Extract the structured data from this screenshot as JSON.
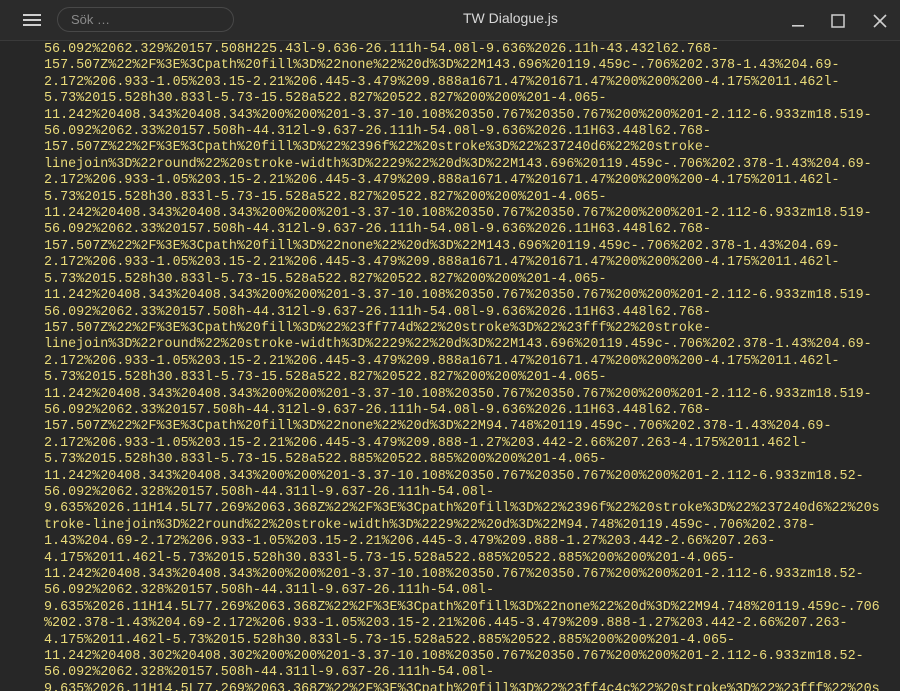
{
  "window": {
    "title": "TW Dialogue.js"
  },
  "search": {
    "placeholder": "Sök …"
  },
  "icons": {
    "menu": "hamburger-icon",
    "minimize": "minimize-icon",
    "maximize": "maximize-icon",
    "close": "close-icon"
  },
  "colors": {
    "text": "#eadb7a",
    "background": "#272727",
    "titlebar": "#2b2b2b"
  },
  "content": {
    "lines": [
      "56.092%2062.329%20157.508H225.43l-9.636-26.111h-54.08l-9.636%2026.11h-43.432l62.768-",
      "157.507Z%22%2F%3E%3Cpath%20fill%3D%22none%22%20d%3D%22M143.696%20119.459c-.706%202.378-1.43%204.69-",
      "2.172%206.933-1.05%203.15-2.21%206.445-3.479%209.888a1671.47%201671.47%200%200%200-4.175%2011.462l-",
      "5.73%2015.528h30.833l-5.73-15.528a522.827%20522.827%200%200%201-4.065-",
      "11.242%20408.343%20408.343%200%200%201-3.37-10.108%20350.767%20350.767%200%200%201-2.112-6.933zm18.519-",
      "56.092%2062.33%20157.508h-44.312l-9.637-26.111h-54.08l-9.636%2026.11H63.448l62.768-",
      "157.507Z%22%2F%3E%3Cpath%20fill%3D%22%2396f%22%20stroke%3D%22%237240d6%22%20stroke-",
      "linejoin%3D%22round%22%20stroke-width%3D%2229%22%20d%3D%22M143.696%20119.459c-.706%202.378-1.43%204.69-",
      "2.172%206.933-1.05%203.15-2.21%206.445-3.479%209.888a1671.47%201671.47%200%200%200-4.175%2011.462l-",
      "5.73%2015.528h30.833l-5.73-15.528a522.827%20522.827%200%200%201-4.065-",
      "11.242%20408.343%20408.343%200%200%201-3.37-10.108%20350.767%20350.767%200%200%201-2.112-6.933zm18.519-",
      "56.092%2062.33%20157.508h-44.312l-9.637-26.111h-54.08l-9.636%2026.11H63.448l62.768-",
      "157.507Z%22%2F%3E%3Cpath%20fill%3D%22none%22%20d%3D%22M143.696%20119.459c-.706%202.378-1.43%204.69-",
      "2.172%206.933-1.05%203.15-2.21%206.445-3.479%209.888a1671.47%201671.47%200%200%200-4.175%2011.462l-",
      "5.73%2015.528h30.833l-5.73-15.528a522.827%20522.827%200%200%201-4.065-",
      "11.242%20408.343%20408.343%200%200%201-3.37-10.108%20350.767%20350.767%200%200%201-2.112-6.933zm18.519-",
      "56.092%2062.33%20157.508h-44.312l-9.637-26.111h-54.08l-9.636%2026.11H63.448l62.768-",
      "157.507Z%22%2F%3E%3Cpath%20fill%3D%22%23ff774d%22%20stroke%3D%22%23fff%22%20stroke-",
      "linejoin%3D%22round%22%20stroke-width%3D%2229%22%20d%3D%22M143.696%20119.459c-.706%202.378-1.43%204.69-",
      "2.172%206.933-1.05%203.15-2.21%206.445-3.479%209.888a1671.47%201671.47%200%200%200-4.175%2011.462l-",
      "5.73%2015.528h30.833l-5.73-15.528a522.827%20522.827%200%200%201-4.065-",
      "11.242%20408.343%20408.343%200%200%201-3.37-10.108%20350.767%20350.767%200%200%201-2.112-6.933zm18.519-",
      "56.092%2062.33%20157.508h-44.312l-9.637-26.111h-54.08l-9.636%2026.11H63.448l62.768-",
      "157.507Z%22%2F%3E%3Cpath%20fill%3D%22none%22%20d%3D%22M94.748%20119.459c-.706%202.378-1.43%204.69-",
      "2.172%206.933-1.05%203.15-2.21%206.445-3.479%209.888-1.27%203.442-2.66%207.263-4.175%2011.462l-",
      "5.73%2015.528h30.833l-5.73-15.528a522.885%20522.885%200%200%201-4.065-",
      "11.242%20408.343%20408.343%200%200%201-3.37-10.108%20350.767%20350.767%200%200%201-2.112-6.933zm18.52-",
      "56.092%2062.328%20157.508h-44.311l-9.637-26.111h-54.08l-",
      "9.635%2026.11H14.5L77.269%2063.368Z%22%2F%3E%3Cpath%20fill%3D%22%2396f%22%20stroke%3D%22%237240d6%22%20s",
      "troke-linejoin%3D%22round%22%20stroke-width%3D%2229%22%20d%3D%22M94.748%20119.459c-.706%202.378-",
      "1.43%204.69-2.172%206.933-1.05%203.15-2.21%206.445-3.479%209.888-1.27%203.442-2.66%207.263-",
      "4.175%2011.462l-5.73%2015.528h30.833l-5.73-15.528a522.885%20522.885%200%200%201-4.065-",
      "11.242%20408.343%20408.343%200%200%201-3.37-10.108%20350.767%20350.767%200%200%201-2.112-6.933zm18.52-",
      "56.092%2062.328%20157.508h-44.311l-9.637-26.111h-54.08l-",
      "9.635%2026.11H14.5L77.269%2063.368Z%22%2F%3E%3Cpath%20fill%3D%22none%22%20d%3D%22M94.748%20119.459c-.706",
      "%202.378-1.43%204.69-2.172%206.933-1.05%203.15-2.21%206.445-3.479%209.888-1.27%203.442-2.66%207.263-",
      "4.175%2011.462l-5.73%2015.528h30.833l-5.73-15.528a522.885%20522.885%200%200%201-4.065-",
      "11.242%20408.302%20408.302%200%200%201-3.37-10.108%20350.767%20350.767%200%200%201-2.112-6.933zm18.52-",
      "56.092%2062.328%20157.508h-44.311l-9.637-26.111h-54.08l-",
      "9.635%2026.11H14.5L77.269%2063.368Z%22%2F%3E%3Cpath%20fill%3D%22%23ff4c4c%22%20stroke%3D%22%23fff%22%20s"
    ]
  }
}
